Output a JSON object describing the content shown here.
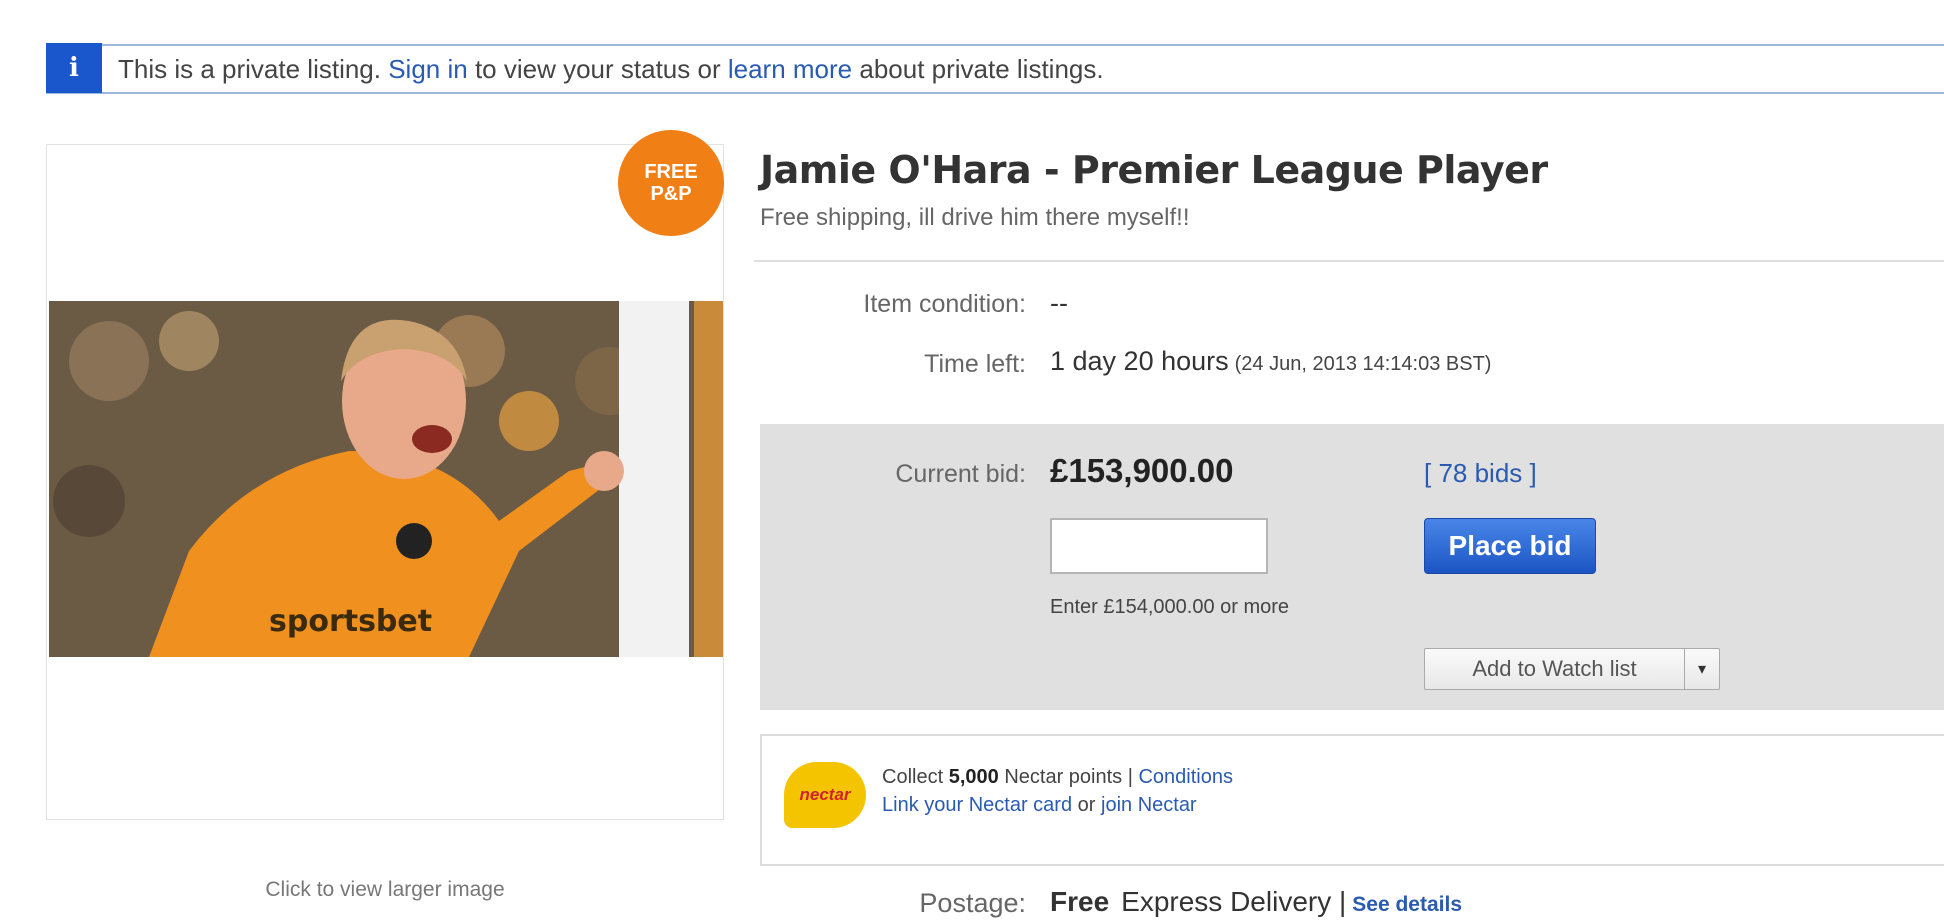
{
  "info_bar": {
    "icon": "info-icon",
    "text_before": "This is a private listing.",
    "sign_in": "Sign in",
    "text_middle": "to view your status or",
    "learn_more": "learn more",
    "text_after": "about private listings."
  },
  "image_panel": {
    "badge_line1": "FREE",
    "badge_line2": "P&P",
    "larger_image_link": "Click to view larger image"
  },
  "listing": {
    "title": "Jamie O'Hara - Premier League Player",
    "subtitle": "Free shipping, ill drive him there myself!!",
    "condition_label": "Item condition:",
    "condition_value": "--",
    "time_left_label": "Time left:",
    "time_left_value": "1 day 20 hours",
    "end_time": "(24 Jun, 2013  14:14:03 BST)"
  },
  "bid": {
    "current_bid_label": "Current bid:",
    "current_bid_value": "£153,900.00",
    "bids_link": "[ 78 bids ]",
    "input_value": "",
    "place_bid_label": "Place bid",
    "enter_hint": "Enter £154,000.00 or more",
    "watch_label": "Add to Watch list",
    "watch_arrow": "▾"
  },
  "nectar": {
    "logo_text": "nectar",
    "collect_text": "Collect",
    "points": "5,000",
    "points_text": "Nectar points |",
    "conditions": "Conditions",
    "link_card": "Link your Nectar card",
    "or_text": "or",
    "join": "join Nectar"
  },
  "postage": {
    "label": "Postage:",
    "free": "Free",
    "method": "Express Delivery |",
    "see_details": "See details"
  },
  "colors": {
    "link": "#2a5bb0",
    "badge": "#f07f16",
    "button": "#1b55c4",
    "bid_box": "#e0e0e0",
    "info_icon": "#1a56cc"
  }
}
